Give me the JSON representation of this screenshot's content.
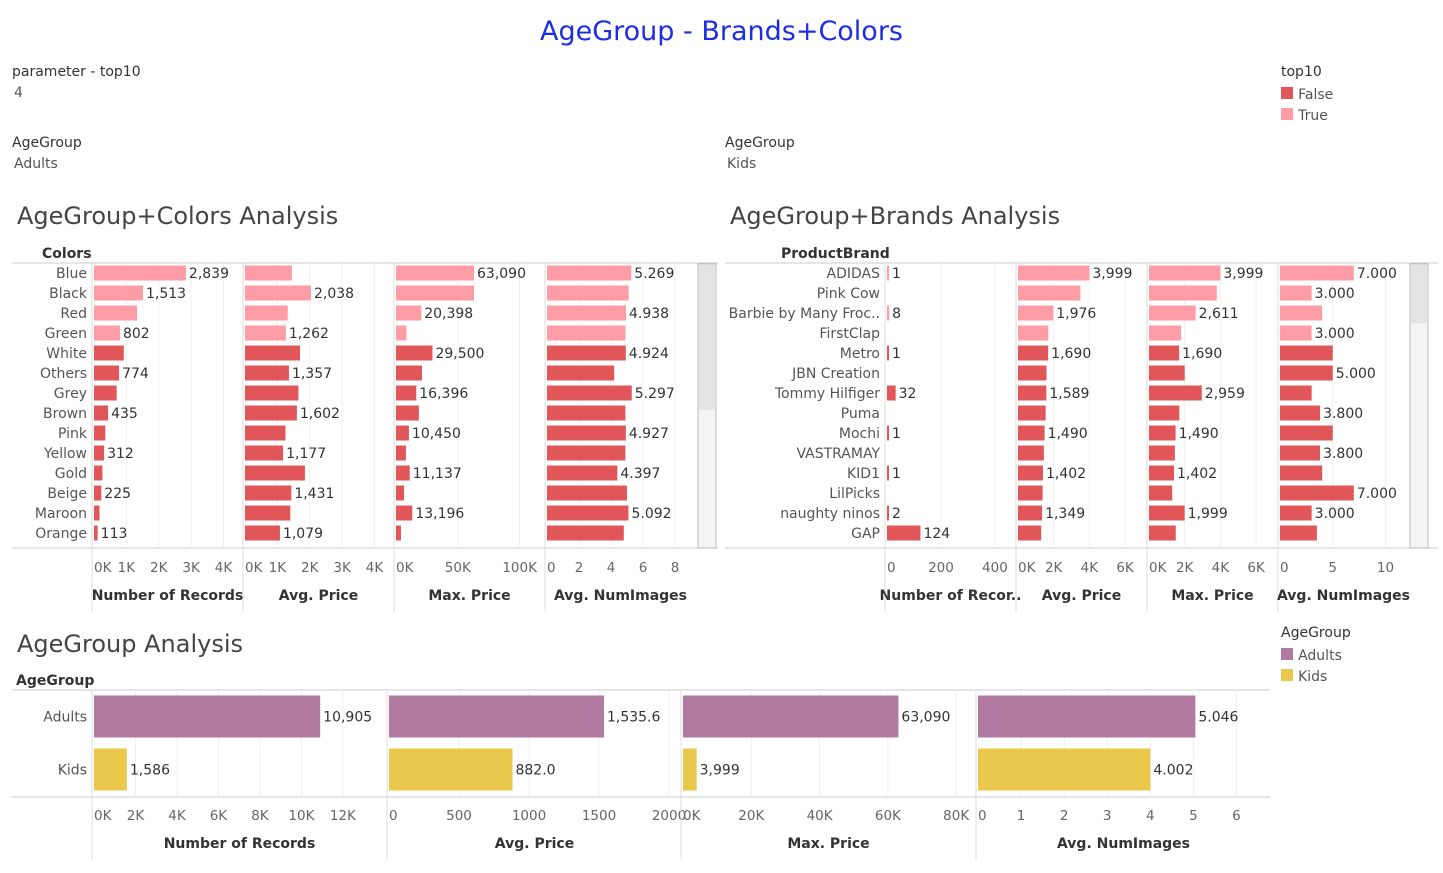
{
  "page": {
    "title": "AgeGroup - Brands+Colors",
    "parameter": {
      "label": "parameter - top10",
      "value": "4"
    },
    "filters": [
      {
        "label": "AgeGroup",
        "value": "Adults"
      },
      {
        "label": "AgeGroup",
        "value": "Kids"
      }
    ],
    "legend_top10": {
      "title": "top10",
      "items": [
        {
          "label": "False",
          "color": "#e15759"
        },
        {
          "label": "True",
          "color": "#ff9da7"
        }
      ]
    },
    "legend_agegroup": {
      "title": "AgeGroup",
      "items": [
        {
          "label": "Adults",
          "color": "#b07aa1"
        },
        {
          "label": "Kids",
          "color": "#e9c84b"
        }
      ]
    },
    "sections": {
      "colors": "AgeGroup+Colors Analysis",
      "brands": "AgeGroup+Brands Analysis",
      "agegroup": "AgeGroup Analysis"
    }
  },
  "chart_data": [
    {
      "id": "colors",
      "type": "bar",
      "row_header": "Colors",
      "categories": [
        "Blue",
        "Black",
        "Red",
        "Green",
        "White",
        "Others",
        "Grey",
        "Brown",
        "Pink",
        "Yellow",
        "Gold",
        "Beige",
        "Maroon",
        "Orange"
      ],
      "top10": [
        true,
        true,
        true,
        true,
        false,
        false,
        false,
        false,
        false,
        false,
        false,
        false,
        false,
        false
      ],
      "measures": [
        {
          "name": "Number of Records",
          "xlim": [
            0,
            4200
          ],
          "ticks": [
            "0K",
            "1K",
            "2K",
            "3K",
            "4K"
          ],
          "values": [
            2839,
            1513,
            1330,
            802,
            920,
            774,
            700,
            435,
            350,
            312,
            260,
            225,
            170,
            113
          ],
          "labels": [
            "2,839",
            "1,513",
            "",
            "802",
            "",
            "774",
            "",
            "435",
            "",
            "312",
            "",
            "225",
            "",
            "113"
          ]
        },
        {
          "name": "Avg. Price",
          "xlim": [
            0,
            4200
          ],
          "ticks": [
            "0K",
            "1K",
            "2K",
            "3K",
            "4K"
          ],
          "values": [
            1450,
            2038,
            1320,
            1262,
            1700,
            1357,
            1650,
            1602,
            1250,
            1177,
            1850,
            1431,
            1400,
            1079
          ],
          "labels": [
            "",
            "2,038",
            "",
            "1,262",
            "",
            "1,357",
            "",
            "1,602",
            "",
            "1,177",
            "",
            "1,431",
            "",
            "1,079"
          ]
        },
        {
          "name": "Max. Price",
          "xlim": [
            0,
            110000
          ],
          "ticks": [
            "0K",
            "50K",
            "100K"
          ],
          "values": [
            63090,
            63090,
            20398,
            8500,
            29500,
            21000,
            16396,
            18500,
            10450,
            8000,
            11137,
            6500,
            13196,
            4000
          ],
          "labels": [
            "63,090",
            "",
            "20,398",
            "",
            "29,500",
            "",
            "16,396",
            "",
            "10,450",
            "",
            "11,137",
            "",
            "13,196",
            ""
          ]
        },
        {
          "name": "Avg. NumImages",
          "xlim": [
            0,
            8.5
          ],
          "ticks": [
            "0",
            "2",
            "4",
            "6",
            "8"
          ],
          "values": [
            5.269,
            5.1,
            4.938,
            4.9,
            4.924,
            4.2,
            5.297,
            4.9,
            4.927,
            4.9,
            4.397,
            5.0,
            5.092,
            4.8
          ],
          "labels": [
            "5.269",
            "",
            "4.938",
            "",
            "4.924",
            "",
            "5.297",
            "",
            "4.927",
            "",
            "4.397",
            "",
            "5.092",
            ""
          ]
        }
      ]
    },
    {
      "id": "brands",
      "type": "bar",
      "row_header": "ProductBrand",
      "categories": [
        "ADIDAS",
        "Pink Cow",
        "Barbie by Many Froc..",
        "FirstClap",
        "Metro",
        "JBN Creation",
        "Tommy Hilfiger",
        "Puma",
        "Mochi",
        "VASTRAMAY",
        "KID1",
        "LilPicks",
        "naughty ninos",
        "GAP"
      ],
      "top10": [
        true,
        true,
        true,
        true,
        false,
        false,
        false,
        false,
        false,
        false,
        false,
        false,
        false,
        false
      ],
      "measures": [
        {
          "name": "Number of Recor..",
          "xlim": [
            0,
            430
          ],
          "ticks": [
            "0",
            "200",
            "400"
          ],
          "values": [
            1,
            0,
            8,
            0,
            1,
            0,
            32,
            0,
            1,
            0,
            1,
            0,
            2,
            124
          ],
          "labels": [
            "1",
            "",
            "8",
            "",
            "1",
            "",
            "32",
            "",
            "1",
            "",
            "1",
            "",
            "2",
            "124"
          ]
        },
        {
          "name": "Avg. Price",
          "xlim": [
            0,
            6500
          ],
          "ticks": [
            "0K",
            "2K",
            "4K",
            "6K"
          ],
          "values": [
            3999,
            3500,
            1976,
            1700,
            1690,
            1600,
            1589,
            1550,
            1490,
            1450,
            1402,
            1380,
            1349,
            1300
          ],
          "labels": [
            "3,999",
            "",
            "1,976",
            "",
            "1,690",
            "",
            "1,589",
            "",
            "1,490",
            "",
            "1,402",
            "",
            "1,349",
            ""
          ]
        },
        {
          "name": "Max. Price",
          "xlim": [
            0,
            6500
          ],
          "ticks": [
            "0K",
            "2K",
            "4K",
            "6K"
          ],
          "values": [
            3999,
            3800,
            2611,
            1800,
            1690,
            2000,
            2959,
            1700,
            1490,
            1450,
            1402,
            1300,
            1999,
            1500
          ],
          "labels": [
            "3,999",
            "",
            "2,611",
            "",
            "1,690",
            "",
            "2,959",
            "",
            "1,490",
            "",
            "1,402",
            "",
            "1,999",
            ""
          ]
        },
        {
          "name": "Avg. NumImages",
          "xlim": [
            0,
            11
          ],
          "ticks": [
            "0",
            "5",
            "10"
          ],
          "values": [
            7.0,
            3.0,
            4.0,
            3.0,
            5.0,
            5.0,
            3.0,
            3.8,
            5.0,
            3.8,
            4.0,
            7.0,
            3.0,
            3.5
          ],
          "labels": [
            "7.000",
            "3.000",
            "",
            "3.000",
            "",
            "5.000",
            "",
            "3.800",
            "",
            "3.800",
            "",
            "7.000",
            "3.000",
            ""
          ]
        }
      ]
    },
    {
      "id": "agegroup",
      "type": "bar",
      "row_header": "AgeGroup",
      "categories": [
        "Adults",
        "Kids"
      ],
      "measures": [
        {
          "name": "Number of Records",
          "xlim": [
            0,
            13500
          ],
          "ticks": [
            "0K",
            "2K",
            "4K",
            "6K",
            "8K",
            "10K",
            "12K"
          ],
          "values": [
            10905,
            1586
          ],
          "labels": [
            "10,905",
            "1,586"
          ]
        },
        {
          "name": "Avg. Price",
          "xlim": [
            0,
            2000
          ],
          "ticks": [
            "0",
            "500",
            "1000",
            "1500",
            "2000"
          ],
          "values": [
            1535.6,
            882.0
          ],
          "labels": [
            "1,535.6",
            "882.0"
          ]
        },
        {
          "name": "Max. Price",
          "xlim": [
            0,
            82000
          ],
          "ticks": [
            "0K",
            "20K",
            "40K",
            "60K",
            "80K"
          ],
          "values": [
            63090,
            3999
          ],
          "labels": [
            "63,090",
            "3,999"
          ]
        },
        {
          "name": "Avg. NumImages",
          "xlim": [
            0,
            6.5
          ],
          "ticks": [
            "0",
            "1",
            "2",
            "3",
            "4",
            "5",
            "6"
          ],
          "values": [
            5.046,
            4.002
          ],
          "labels": [
            "5.046",
            "4.002"
          ]
        }
      ]
    }
  ]
}
